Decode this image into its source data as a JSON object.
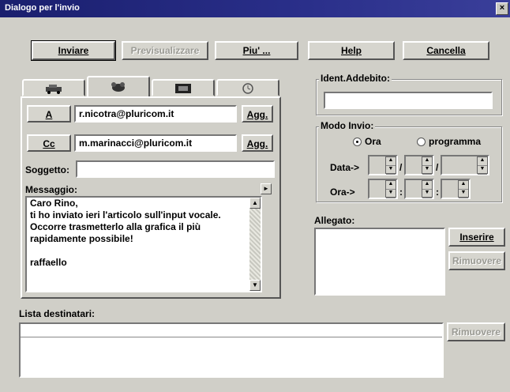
{
  "window": {
    "title": "Dialogo per l'invio",
    "close_glyph": "×"
  },
  "toolbar": {
    "send": "Inviare",
    "preview": "Previsualizzare",
    "more": "Piu' ...",
    "help": "Help",
    "cancel": "Cancella"
  },
  "tabs": [
    {
      "icon": "car-icon"
    },
    {
      "icon": "dog-icon"
    },
    {
      "icon": "film-icon"
    },
    {
      "icon": "clock-icon"
    }
  ],
  "recipients": {
    "to_button": "A",
    "to_value": "r.nicotra@pluricom.it",
    "to_add": "Agg.",
    "cc_button": "Cc",
    "cc_value": "m.marinacci@pluricom.it",
    "cc_add": "Agg."
  },
  "subject": {
    "label": "Soggetto:",
    "value": ""
  },
  "message": {
    "label": "Messaggio:",
    "lines": [
      "Caro Rino,",
      "ti ho inviato ieri l'articolo sull'input vocale.",
      "Occorre trasmetterlo alla grafica il più",
      "rapidamente possibile!",
      "",
      "raffaello"
    ]
  },
  "ident": {
    "label": "Ident.Addebito:",
    "value": ""
  },
  "send_mode": {
    "label": "Modo Invio:",
    "now": "Ora",
    "scheduled": "programma",
    "selected": "now",
    "date_label": "Data->",
    "time_label": "Ora->",
    "date_sep": "/",
    "time_sep": ":"
  },
  "attachment": {
    "label": "Allegato:",
    "insert": "Inserire",
    "remove": "Rimuovere"
  },
  "dest_list": {
    "label": "Lista destinatari:",
    "remove": "Rimuovere"
  }
}
